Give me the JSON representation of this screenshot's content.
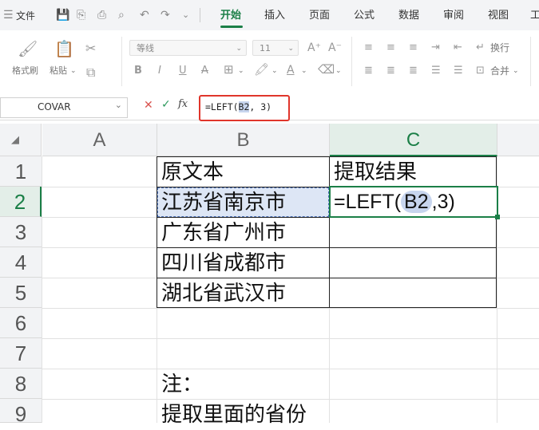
{
  "quick_access": {
    "menu_icon": "☰",
    "file_label": "文件"
  },
  "menu_tabs": [
    "开始",
    "插入",
    "页面",
    "公式",
    "数据",
    "审阅",
    "视图",
    "工"
  ],
  "ribbon": {
    "format_painter": "格式刷",
    "paste": "粘贴",
    "font_name": "等线",
    "font_size": "11",
    "bold": "B",
    "italic": "I",
    "underline": "U",
    "wrap_text": "换行",
    "merge": "合并"
  },
  "formula_bar": {
    "name_box": "COVAR",
    "cancel": "✕",
    "confirm": "✓",
    "fx": "fx",
    "formula_prefix": "=LEFT(",
    "formula_ref": "B2",
    "formula_suffix": ", 3)"
  },
  "grid": {
    "columns": [
      "A",
      "B",
      "C"
    ],
    "rows": [
      "1",
      "2",
      "3",
      "4",
      "5",
      "6",
      "7",
      "8",
      "9"
    ],
    "cells": {
      "B1": "原文本",
      "C1": "提取结果",
      "B2": "江苏省南京市",
      "C2_prefix": "=LEFT(",
      "C2_ref": "B2",
      "C2_suffix": ",3)",
      "B3": "广东省广州市",
      "B4": "四川省成都市",
      "B5": "湖北省武汉市",
      "B8": "注：",
      "B9": "提取里面的省份"
    }
  },
  "colors": {
    "accent": "#1b7f47",
    "formula_highlight": "#e0352b",
    "ref_highlight": "#c7d5ee"
  }
}
